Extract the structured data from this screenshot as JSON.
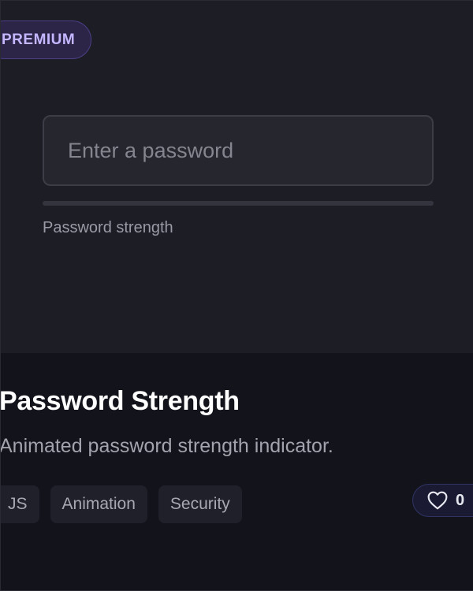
{
  "badge": {
    "label": "PREMIUM"
  },
  "password": {
    "placeholder": "Enter a password",
    "value": "",
    "strength": 0,
    "strength_label": "Password strength"
  },
  "card": {
    "title": "Password Strength",
    "description": "Animated password strength indicator.",
    "tags": [
      "JS",
      "Animation",
      "Security"
    ],
    "likes": "0"
  },
  "colors": {
    "accent": "#6c5ce7",
    "badge_text": "#c4b6ff",
    "badge_bg": "#2c2548",
    "like_bg": "#1a1b33"
  },
  "icons": {
    "like": "heart-icon"
  }
}
